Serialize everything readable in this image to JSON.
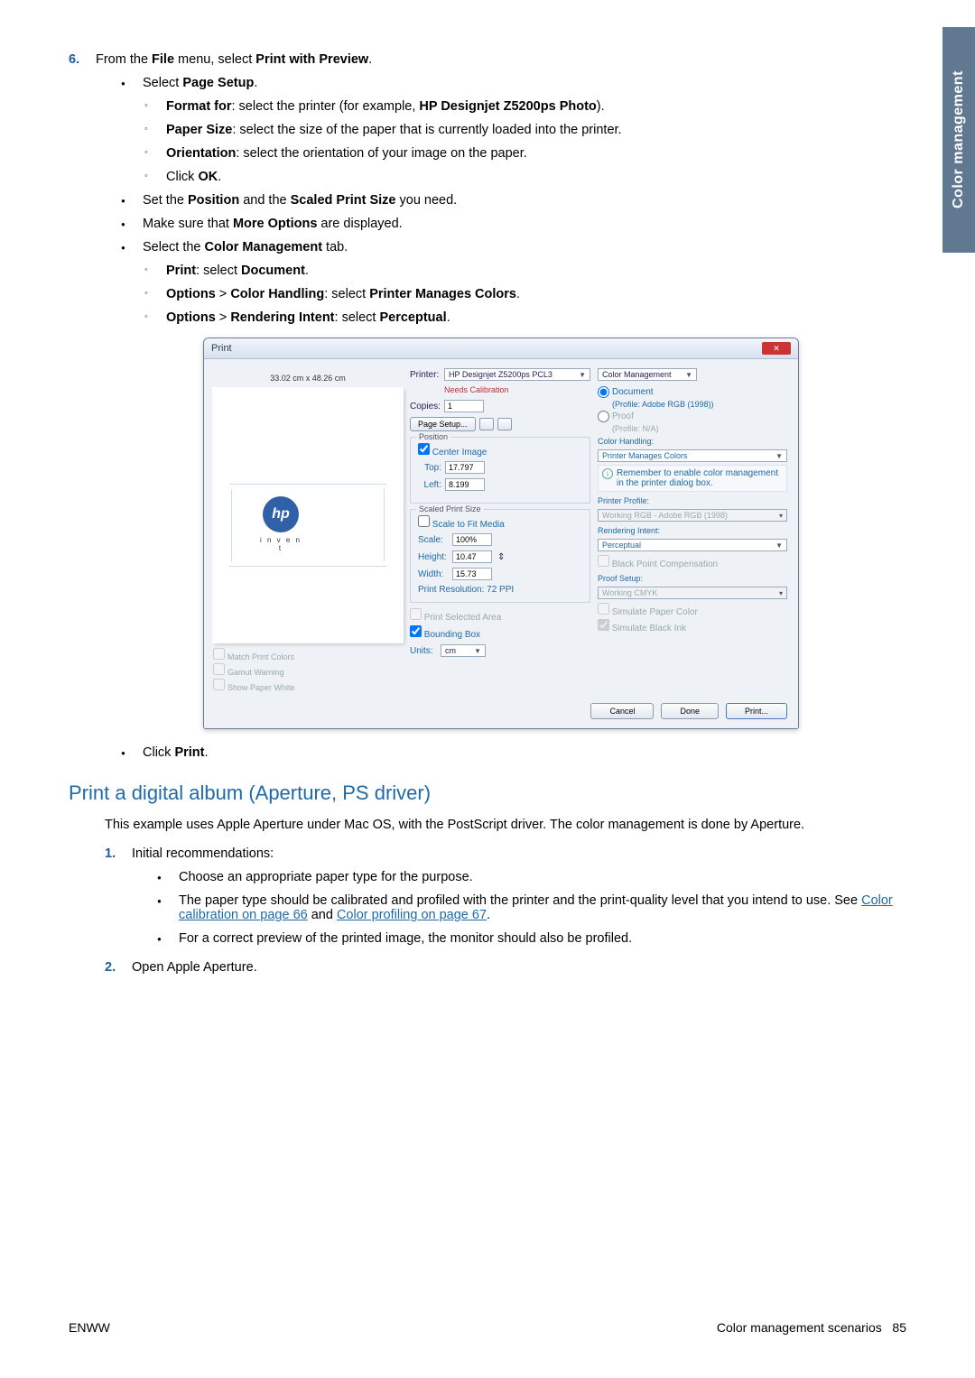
{
  "side_tab": "Color management",
  "s6": {
    "num": "6.",
    "intro_pre": "From the ",
    "intro_file": "File",
    "intro_mid": " menu, select ",
    "intro_pwp": "Print with Preview",
    "intro_end": ".",
    "page_setup_pre": "Select ",
    "page_setup": "Page Setup",
    "ff_b": "Format for",
    "ff_t": ": select the printer (for example, ",
    "ff_b2": "HP Designjet Z5200ps Photo",
    "ff_e": ").",
    "ps_b": "Paper Size",
    "ps_t": ": select the size of the paper that is currently loaded into the printer.",
    "or_b": "Orientation",
    "or_t": ": select the orientation of your image on the paper.",
    "ok_pre": "Click ",
    "ok_b": "OK",
    "pos_pre": "Set the ",
    "pos_b1": "Position",
    "pos_mid": " and the ",
    "pos_b2": "Scaled Print Size",
    "pos_end": " you need.",
    "mo_pre": "Make sure that ",
    "mo_b": "More Options",
    "mo_end": " are displayed.",
    "cm_pre": "Select the ",
    "cm_b": "Color Management",
    "cm_end": " tab.",
    "pr_b1": "Print",
    "pr_mid": ": select ",
    "pr_b2": "Document",
    "ch_b1": "Options",
    "ch_gt": " > ",
    "ch_b2": "Color Handling",
    "ch_mid": ": select ",
    "ch_b3": "Printer Manages Colors",
    "ri_b1": "Options",
    "ri_b2": "Rendering Intent",
    "ri_mid": ": select ",
    "ri_b3": "Perceptual",
    "click_print_pre": "Click ",
    "click_print_b": "Print"
  },
  "dlg": {
    "title": "Print",
    "dims": "33.02 cm x 48.26 cm",
    "hp_logo_txt": "hp",
    "hp_invent": "i n v e n t",
    "match": "Match Print Colors",
    "gamut": "Gamut Warning",
    "paperwhite": "Show Paper White",
    "printer_lbl": "Printer:",
    "printer_val": "HP Designjet Z5200ps PCL3",
    "needs_cal": "Needs Calibration",
    "copies_lbl": "Copies:",
    "copies_val": "1",
    "page_setup_btn": "Page Setup...",
    "pos_title": "Position",
    "center": "Center Image",
    "top_lbl": "Top:",
    "top_val": "17.797",
    "left_lbl": "Left:",
    "left_val": "8.199",
    "sps_title": "Scaled Print Size",
    "scale_fit": "Scale to Fit Media",
    "scale_lbl": "Scale:",
    "scale_val": "100%",
    "height_lbl": "Height:",
    "height_val": "10.47",
    "width_lbl": "Width:",
    "width_val": "15.73",
    "res_lbl": "Print Resolution: 72 PPI",
    "psa": "Print Selected Area",
    "bb": "Bounding Box",
    "units_lbl": "Units:",
    "units_val": "cm",
    "cm_sel": "Color Management",
    "doc": "Document",
    "doc_prof": "(Profile: Adobe RGB (1998))",
    "proof": "Proof",
    "proof_prof": "(Profile: N/A)",
    "handling_lbl": "Color Handling:",
    "handling_val": "Printer Manages Colors",
    "reminder": "Remember to enable color management in the printer dialog box.",
    "pp_lbl": "Printer Profile:",
    "pp_val": "Working RGB - Adobe RGB (1998)",
    "ri_lbl": "Rendering Intent:",
    "ri_val": "Perceptual",
    "bpc": "Black Point Compensation",
    "proofs_lbl": "Proof Setup:",
    "proofs_val": "Working CMYK",
    "spc": "Simulate Paper Color",
    "sbi": "Simulate Black Ink",
    "cancel": "Cancel",
    "done": "Done",
    "print": "Print..."
  },
  "h2": "Print a digital album (Aperture, PS driver)",
  "intro": "This example uses Apple Aperture under Mac OS, with the PostScript driver. The color management is done by Aperture.",
  "s1": {
    "num": "1.",
    "title": "Initial recommendations:",
    "b1": "Choose an appropriate paper type for the purpose.",
    "b2_pre": "The paper type should be calibrated and profiled with the printer and the print-quality level that you intend to use. See ",
    "b2_link1": "Color calibration on page 66",
    "b2_mid": " and ",
    "b2_link2": "Color profiling on page 67",
    "b2_end": ".",
    "b3": "For a correct preview of the printed image, the monitor should also be profiled."
  },
  "s2": {
    "num": "2.",
    "title": "Open Apple Aperture."
  },
  "footer_left": "ENWW",
  "footer_right_text": "Color management scenarios",
  "footer_page": "85"
}
